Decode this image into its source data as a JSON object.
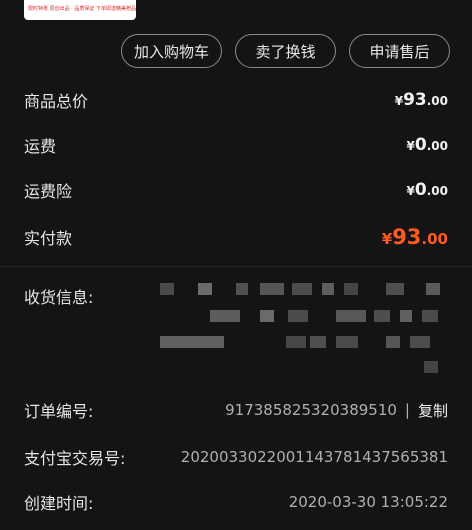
{
  "product": {
    "thumb_text": "限时特惠 原创出品 · 品质保证 下单即送精美赠品"
  },
  "actions": [
    {
      "label": "加入购物车"
    },
    {
      "label": "卖了换钱"
    },
    {
      "label": "申请售后"
    }
  ],
  "prices": {
    "goods_total": {
      "label": "商品总价",
      "yen": "¥",
      "int": "93",
      "dec": ".00"
    },
    "shipping": {
      "label": "运费",
      "yen": "¥",
      "int": "0",
      "dec": ".00"
    },
    "shipping_insurance": {
      "label": "运费险",
      "yen": "¥",
      "int": "0",
      "dec": ".00"
    },
    "paid": {
      "label": "实付款",
      "yen": "¥",
      "int": "93",
      "dec": ".00"
    }
  },
  "address": {
    "label": "收货信息:"
  },
  "order_info": {
    "order_no_label": "订单编号:",
    "order_no": "917385825320389510",
    "copy_sep": "|",
    "copy_label": "复制",
    "alipay_label": "支付宝交易号:",
    "alipay_no": "2020033022001143781437565381",
    "created_label": "创建时间:",
    "created_at": "2020-03-30 13:05:22"
  },
  "colors": {
    "background": "#141414",
    "accent": "#ff5a1f"
  }
}
